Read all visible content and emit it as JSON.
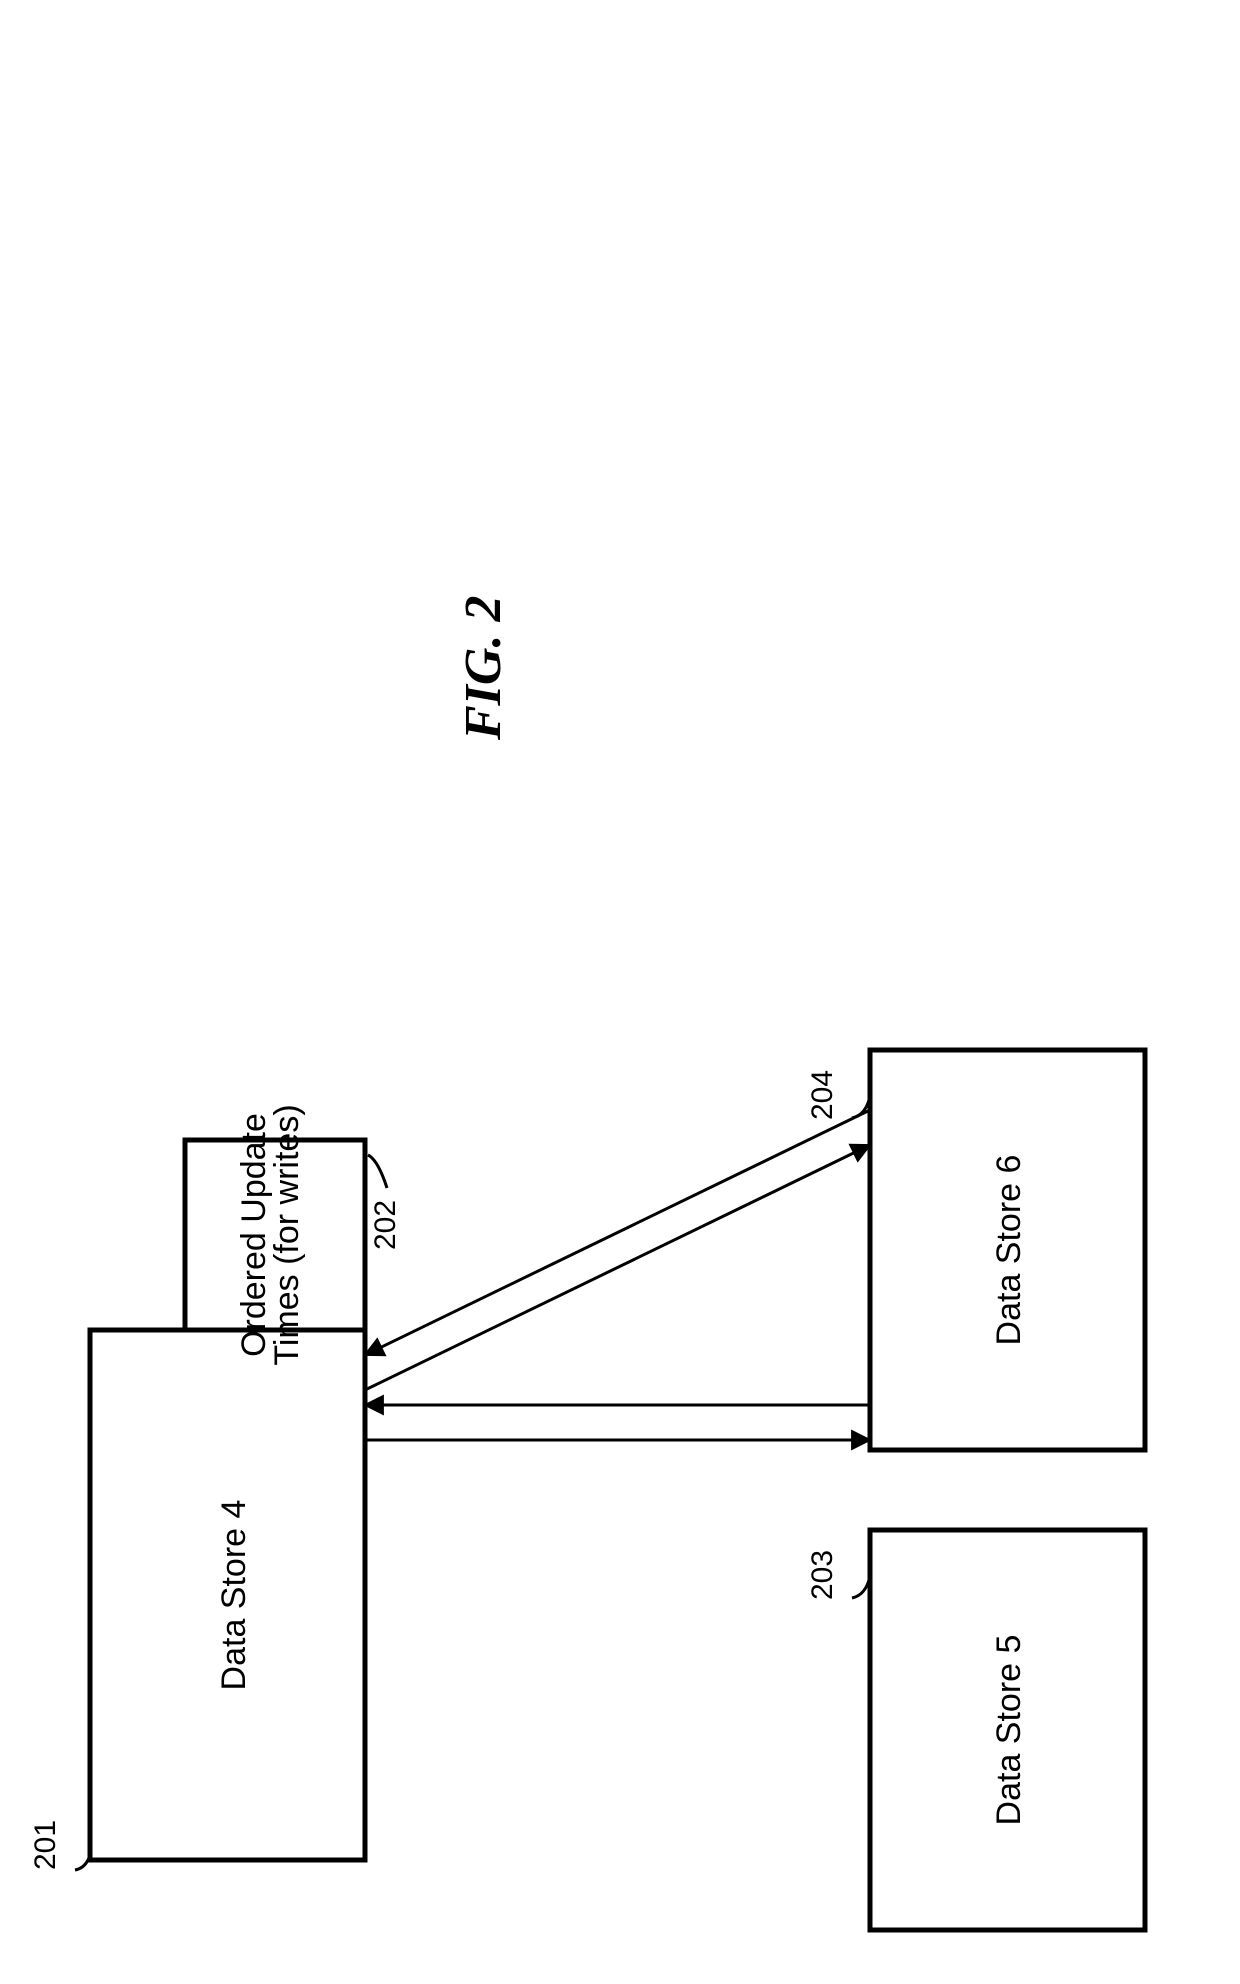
{
  "figure": {
    "title": "FIG. 2"
  },
  "nodes": {
    "store4": {
      "label": "Data Store 4",
      "ref": "201"
    },
    "updateTimes": {
      "line1": "Ordered Update",
      "line2": "Times (for writes)",
      "ref": "202"
    },
    "store5": {
      "label": "Data Store 5",
      "ref": "203"
    },
    "store6": {
      "label": "Data Store 6",
      "ref": "204"
    }
  }
}
